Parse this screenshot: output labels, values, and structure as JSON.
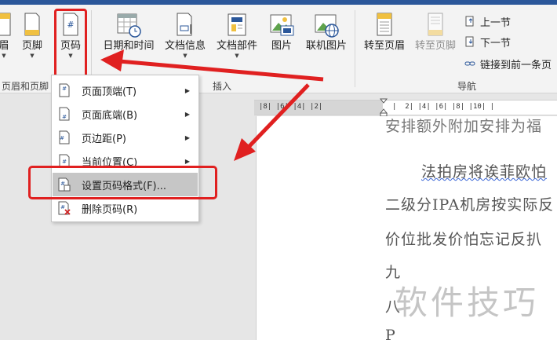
{
  "ribbon": {
    "groups": {
      "header_footer": "页眉和页脚",
      "insert": "插入",
      "nav": "导航"
    },
    "buttons": {
      "header": "眉",
      "footer": "页脚",
      "page_number": "页码",
      "date_time": "日期和时间",
      "doc_info": "文档信息",
      "doc_parts": "文档部件",
      "picture": "图片",
      "online_picture": "联机图片",
      "goto_header": "转至页眉",
      "goto_footer": "转至页脚"
    },
    "nav_items": {
      "previous": "上一节",
      "next": "下一节",
      "link_previous": "链接到前一条页"
    }
  },
  "menu": {
    "items": [
      {
        "label": "页面顶端(T)",
        "has_submenu": true
      },
      {
        "label": "页面底端(B)",
        "has_submenu": true
      },
      {
        "label": "页边距(P)",
        "has_submenu": true
      },
      {
        "label": "当前位置(C)",
        "has_submenu": true
      },
      {
        "label": "设置页码格式(F)...",
        "has_submenu": false,
        "highlighted": true
      },
      {
        "label": "删除页码(R)",
        "has_submenu": false
      }
    ]
  },
  "ruler": {
    "left_ticks": "|8| |6| |4| |2| ",
    "right_ticks": "|  2| |4| |6| |8| |10| |"
  },
  "document": {
    "lines": [
      "安排额外附加安排为福",
      "法拍房将诶菲欧怕",
      "二级分IPA机房按实际反",
      "价位批发价怕忘记反扒",
      "九",
      "八",
      "P"
    ],
    "watermark": "软件技巧"
  },
  "colors": {
    "accent": "#2b579a",
    "highlight_red": "#e02020",
    "squiggle_blue": "#3a66d6"
  }
}
